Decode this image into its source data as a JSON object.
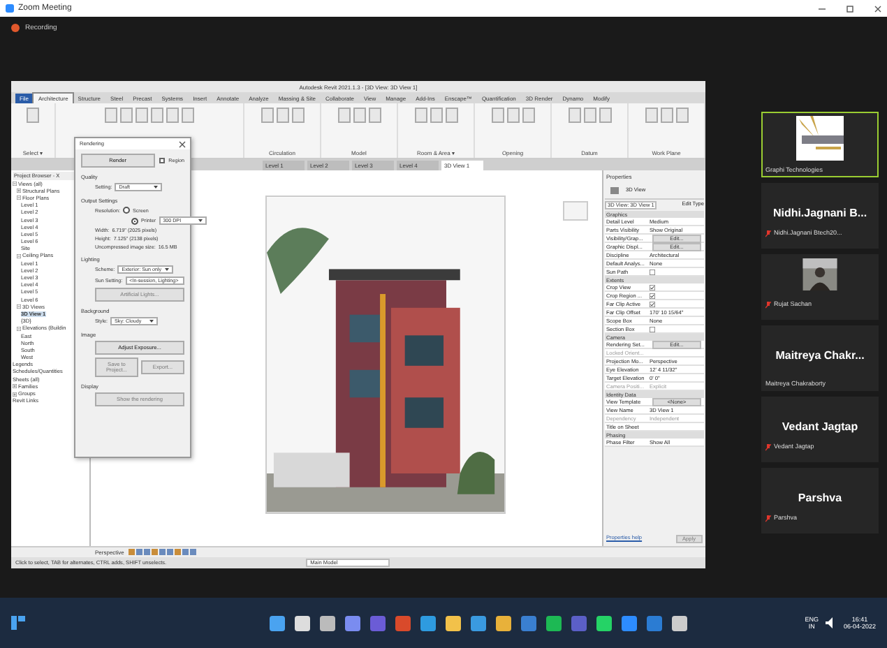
{
  "window": {
    "title": "Zoom Meeting",
    "recording": "Recording"
  },
  "revit": {
    "title": "Autodesk Revit 2021.1.3 - [3D View: 3D View 1]",
    "ribbon_tabs": [
      {
        "label": "File",
        "selected": false
      },
      {
        "label": "Architecture",
        "selected": true
      },
      {
        "label": "Structure",
        "selected": false
      },
      {
        "label": "Steel",
        "selected": false
      },
      {
        "label": "Precast",
        "selected": false
      },
      {
        "label": "Systems",
        "selected": false
      },
      {
        "label": "Insert",
        "selected": false
      },
      {
        "label": "Annotate",
        "selected": false
      },
      {
        "label": "Analyze",
        "selected": false
      },
      {
        "label": "Massing & Site",
        "selected": false
      },
      {
        "label": "Collaborate",
        "selected": false
      },
      {
        "label": "View",
        "selected": false
      },
      {
        "label": "Manage",
        "selected": false
      },
      {
        "label": "Add-Ins",
        "selected": false
      },
      {
        "label": "Enscape™",
        "selected": false
      },
      {
        "label": "Quantification",
        "selected": false
      },
      {
        "label": "3D Render",
        "selected": false
      },
      {
        "label": "Dynamo",
        "selected": false
      },
      {
        "label": "Modify",
        "selected": false
      }
    ],
    "ribbon_panels": [
      "Select ▾",
      "Circulation",
      "Model",
      "Room & Area ▾",
      "Opening",
      "Datum",
      "Work Plane"
    ],
    "view_tabs": [
      {
        "label": "Level 1",
        "selected": false
      },
      {
        "label": "Level 2",
        "selected": false
      },
      {
        "label": "Level 3",
        "selected": false
      },
      {
        "label": "Level 4",
        "selected": false
      },
      {
        "label": "3D View 1",
        "selected": true
      }
    ],
    "project_browser": {
      "title": "Project Browser - X",
      "tree": [
        {
          "label": "Views (all)",
          "expanded": true,
          "children": [
            {
              "label": "Structural Plans",
              "expanded": false
            },
            {
              "label": "Floor Plans",
              "expanded": true,
              "children": [
                {
                  "label": "Level 1"
                },
                {
                  "label": "Level 2"
                },
                {
                  "label": "Level 3"
                },
                {
                  "label": "Level 4"
                },
                {
                  "label": "Level 5"
                },
                {
                  "label": "Level 6"
                },
                {
                  "label": "Site"
                }
              ]
            },
            {
              "label": "Ceiling Plans",
              "expanded": true,
              "children": [
                {
                  "label": "Level 1"
                },
                {
                  "label": "Level 2"
                },
                {
                  "label": "Level 3"
                },
                {
                  "label": "Level 4"
                },
                {
                  "label": "Level 5"
                },
                {
                  "label": "Level 6"
                }
              ]
            },
            {
              "label": "3D Views",
              "expanded": true,
              "children": [
                {
                  "label": "3D View 1",
                  "selected": true
                },
                {
                  "label": "{3D}"
                }
              ]
            },
            {
              "label": "Elevations (Buildin",
              "expanded": true,
              "children": [
                {
                  "label": "East"
                },
                {
                  "label": "North"
                },
                {
                  "label": "South"
                },
                {
                  "label": "West"
                }
              ]
            }
          ]
        },
        {
          "label": "Legends"
        },
        {
          "label": "Schedules/Quantities"
        },
        {
          "label": "Sheets (all)"
        },
        {
          "label": "Families",
          "expanded": false
        },
        {
          "label": "Groups",
          "expanded": false
        },
        {
          "label": "Revit Links"
        }
      ]
    },
    "rendering_dialog": {
      "title": "Rendering",
      "render_button": "Render",
      "region": {
        "label": "Region",
        "checked": false
      },
      "sections": [
        {
          "title": "Quality",
          "rows": [
            {
              "kind": "select",
              "label": "Setting:",
              "value": "Draft"
            }
          ]
        },
        {
          "title": "Output Settings",
          "rows": [
            {
              "kind": "radio",
              "label": "Resolution:",
              "value": "Screen",
              "selected": false
            },
            {
              "kind": "radio",
              "label": "",
              "value": "Printer",
              "selected": true,
              "extra": "300 DPI"
            },
            {
              "kind": "text",
              "label": "Width:",
              "value": "6.719\" (2025 pixels)"
            },
            {
              "kind": "text",
              "label": "Height:",
              "value": "7.125\" (2138 pixels)"
            },
            {
              "kind": "text",
              "label": "Uncompressed image size:",
              "value": "16.5 MB"
            }
          ]
        },
        {
          "title": "Lighting",
          "rows": [
            {
              "kind": "select",
              "label": "Scheme:",
              "value": "Exterior: Sun only"
            },
            {
              "kind": "select",
              "label": "Sun Setting:",
              "value": "<In-session, Lighting>"
            },
            {
              "kind": "button",
              "value": "Artificial Lights...",
              "disabled": true
            }
          ]
        },
        {
          "title": "Background",
          "rows": [
            {
              "kind": "select",
              "label": "Style:",
              "value": "Sky: Cloudy"
            }
          ]
        },
        {
          "title": "Image",
          "rows": [
            {
              "kind": "button",
              "value": "Adjust Exposure...",
              "disabled": false
            },
            {
              "kind": "buttons",
              "values": [
                "Save to Project...",
                "Export..."
              ],
              "disabled": true
            }
          ]
        },
        {
          "title": "Display",
          "rows": [
            {
              "kind": "button",
              "value": "Show the rendering",
              "disabled": true
            }
          ]
        }
      ]
    },
    "properties": {
      "title": "Properties",
      "type": "3D View",
      "selector": "3D View: 3D View 1",
      "edit_type": "Edit Type",
      "groups": [
        {
          "title": "Graphics",
          "rows": [
            {
              "name": "Detail Level",
              "value": "Medium"
            },
            {
              "name": "Parts Visibility",
              "value": "Show Original"
            },
            {
              "name": "Visibility/Grap...",
              "value": "Edit...",
              "kind": "button"
            },
            {
              "name": "Graphic Displ...",
              "value": "Edit...",
              "kind": "button"
            },
            {
              "name": "Discipline",
              "value": "Architectural"
            },
            {
              "name": "Default Analys...",
              "value": "None"
            },
            {
              "name": "Sun Path",
              "kind": "check",
              "checked": false
            }
          ]
        },
        {
          "title": "Extents",
          "rows": [
            {
              "name": "Crop View",
              "kind": "check",
              "checked": true
            },
            {
              "name": "Crop Region ...",
              "kind": "check",
              "checked": true
            },
            {
              "name": "Far Clip Active",
              "kind": "check",
              "checked": true
            },
            {
              "name": "Far Clip Offset",
              "value": "170' 10 15/64\""
            },
            {
              "name": "Scope Box",
              "value": "None"
            },
            {
              "name": "Section Box",
              "kind": "check",
              "checked": false
            }
          ]
        },
        {
          "title": "Camera",
          "rows": [
            {
              "name": "Rendering Set...",
              "value": "Edit...",
              "kind": "button"
            },
            {
              "name": "Locked Orient...",
              "disabled": true
            },
            {
              "name": "Projection Mo...",
              "value": "Perspective"
            },
            {
              "name": "Eye Elevation",
              "value": "12' 4 11/32\""
            },
            {
              "name": "Target Elevation",
              "value": "0' 0\""
            },
            {
              "name": "Camera Positi...",
              "value": "Explicit",
              "disabled": true
            }
          ]
        },
        {
          "title": "Identity Data",
          "rows": [
            {
              "name": "View Template",
              "value": "<None>",
              "kind": "button"
            },
            {
              "name": "View Name",
              "value": "3D View 1"
            },
            {
              "name": "Dependency",
              "value": "Independent",
              "disabled": true
            },
            {
              "name": "Title on Sheet"
            }
          ]
        },
        {
          "title": "Phasing",
          "rows": [
            {
              "name": "Phase Filter",
              "value": "Show All"
            }
          ]
        }
      ],
      "help": "Properties help",
      "apply": "Apply"
    },
    "view_control": "Perspective",
    "status": "Click to select, TAB for alternates, CTRL adds, SHIFT unselects.",
    "model": "Main Model"
  },
  "participants": [
    {
      "kind": "picture",
      "label": "Graphi Technologies",
      "active": true,
      "muted": false
    },
    {
      "kind": "name",
      "name": "Nidhi.Jagnani  B...",
      "label": "Nidhi.Jagnani Btech20...",
      "active": false,
      "muted": true
    },
    {
      "kind": "picture",
      "label": "Rujat Sachan",
      "active": false,
      "muted": true
    },
    {
      "kind": "name",
      "name": "Maitreya  Chakr...",
      "label": "Maitreya Chakraborty",
      "active": false,
      "muted": false
    },
    {
      "kind": "name",
      "name": "Vedant Jagtap",
      "label": "Vedant Jagtap",
      "active": false,
      "muted": true
    },
    {
      "kind": "name",
      "name": "Parshva",
      "label": "Parshva",
      "active": false,
      "muted": true
    }
  ],
  "taskbar": {
    "lang": "ENG",
    "region": "IN",
    "time": "16:41",
    "date": "06-04-2022"
  }
}
